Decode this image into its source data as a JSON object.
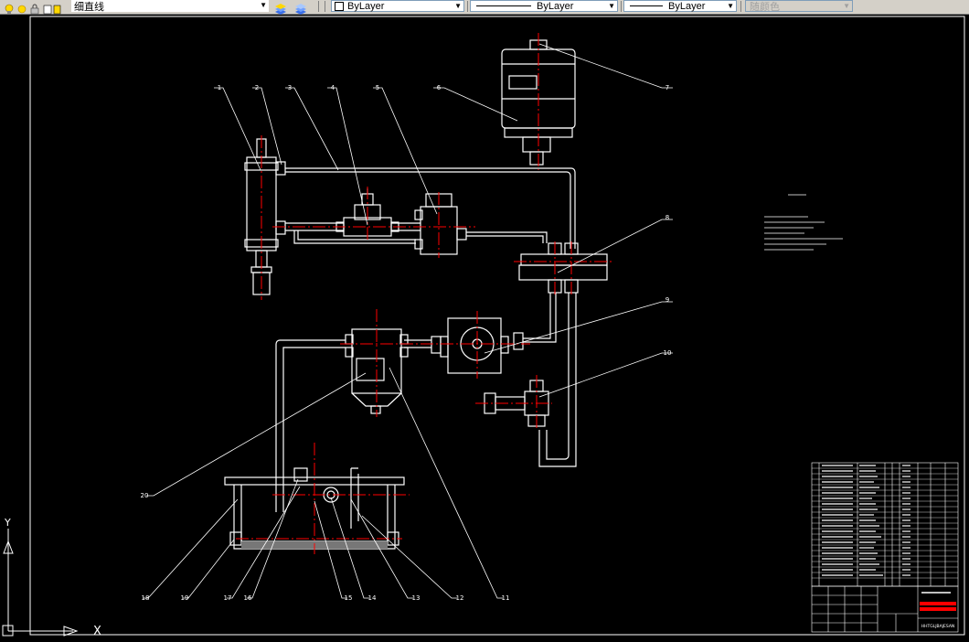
{
  "toolbar": {
    "layer_name": "细直线",
    "color_value": "ByLayer",
    "linetype_value": "ByLayer",
    "lineweight_value": "ByLayer",
    "plotstyle_value": "随颜色"
  },
  "drawing": {
    "part_numbers": [
      "1",
      "2",
      "3",
      "4",
      "5",
      "6",
      "7",
      "8",
      "9",
      "10",
      "11",
      "12",
      "13",
      "14",
      "15",
      "16",
      "17",
      "18",
      "19",
      "20"
    ],
    "title_block_ref": "HHTGLJBAJESAN"
  },
  "ucs": {
    "x_label": "X",
    "y_label": "Y"
  },
  "colors": {
    "background": "#000000",
    "lines": "#ffffff",
    "centerlines": "#ff0000",
    "title_red": "#ff0000"
  }
}
